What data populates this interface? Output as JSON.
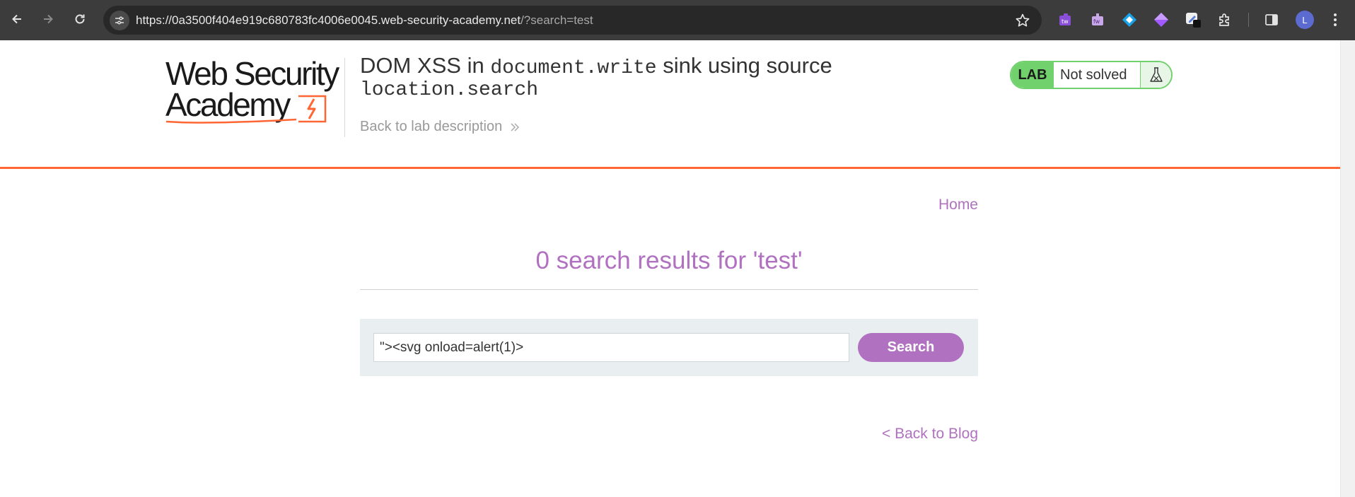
{
  "browser": {
    "url_host": "https://0a3500f404e919c680783fc4006e0045.web-security-academy.net",
    "url_path": "/?search=test",
    "profile_initial": "L",
    "extensions": [
      "tw-extension-icon",
      "fw-extension-icon",
      "diamond-extension-icon",
      "purple-diamond-extension-icon",
      "pen-extension-icon",
      "puzzle-extensions-icon"
    ]
  },
  "header": {
    "logo_line1": "Web Security",
    "logo_line2": "Academy",
    "title_part1": "DOM XSS in ",
    "title_code1": "document.write",
    "title_part2": " sink using source",
    "title_code2": "location.search",
    "back_link": "Back to lab description",
    "badge_label": "LAB",
    "badge_status": "Not solved"
  },
  "nav": {
    "home": "Home"
  },
  "main": {
    "results_heading": "0 search results for 'test'",
    "search_value": "\"><svg onload=alert(1)>",
    "search_button": "Search",
    "back_to_blog": "< Back to Blog"
  },
  "colors": {
    "accent": "#b071c0",
    "header_rule": "#ff6633",
    "badge_green": "#70d16d"
  }
}
